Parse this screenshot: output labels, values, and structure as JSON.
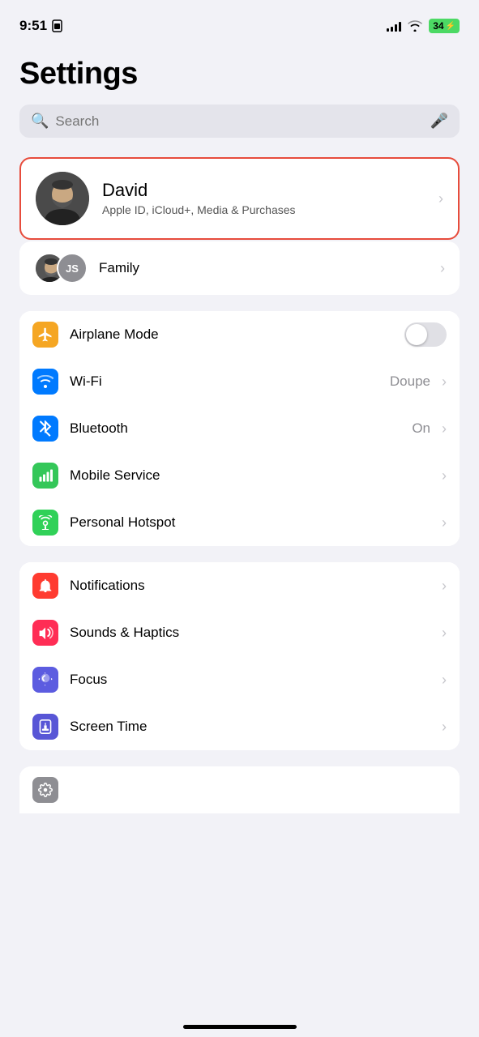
{
  "statusBar": {
    "time": "9:51",
    "battery": "34"
  },
  "page": {
    "title": "Settings"
  },
  "search": {
    "placeholder": "Search"
  },
  "profile": {
    "name": "David",
    "subtitle": "Apple ID, iCloud+, Media & Purchases"
  },
  "family": {
    "label": "Family",
    "memberInitials": "JS"
  },
  "connectivitySection": [
    {
      "id": "airplane-mode",
      "label": "Airplane Mode",
      "iconBg": "icon-orange",
      "hasToggle": true,
      "toggleOn": false,
      "value": "",
      "icon": "✈"
    },
    {
      "id": "wifi",
      "label": "Wi-Fi",
      "iconBg": "icon-blue",
      "hasToggle": false,
      "value": "Doupe",
      "icon": "wifi"
    },
    {
      "id": "bluetooth",
      "label": "Bluetooth",
      "iconBg": "icon-blue-dark",
      "hasToggle": false,
      "value": "On",
      "icon": "bluetooth"
    },
    {
      "id": "mobile-service",
      "label": "Mobile Service",
      "iconBg": "icon-green",
      "hasToggle": false,
      "value": "",
      "icon": "cellular"
    },
    {
      "id": "personal-hotspot",
      "label": "Personal Hotspot",
      "iconBg": "icon-green2",
      "hasToggle": false,
      "value": "",
      "icon": "hotspot"
    }
  ],
  "notificationsSection": [
    {
      "id": "notifications",
      "label": "Notifications",
      "iconBg": "icon-red",
      "icon": "bell",
      "value": ""
    },
    {
      "id": "sounds-haptics",
      "label": "Sounds & Haptics",
      "iconBg": "icon-pink",
      "icon": "speaker",
      "value": ""
    },
    {
      "id": "focus",
      "label": "Focus",
      "iconBg": "icon-indigo",
      "icon": "moon",
      "value": ""
    },
    {
      "id": "screen-time",
      "label": "Screen Time",
      "iconBg": "icon-purple",
      "icon": "hourglass",
      "value": ""
    }
  ]
}
